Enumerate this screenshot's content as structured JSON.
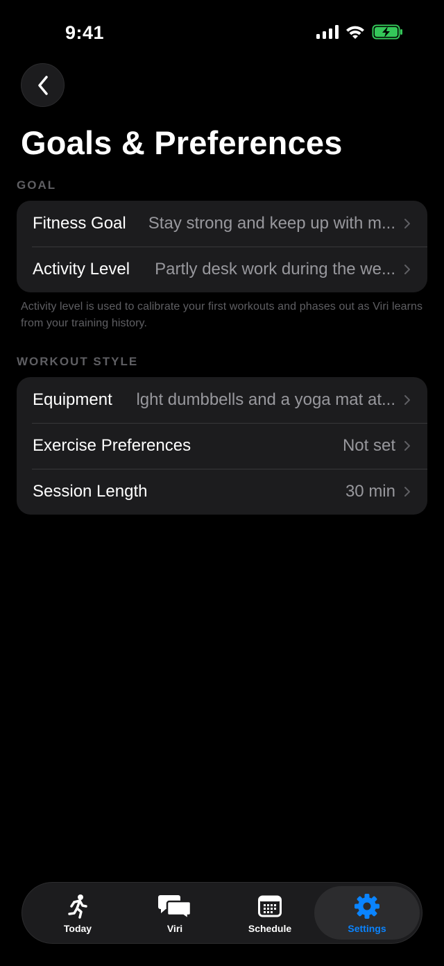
{
  "status_bar": {
    "time": "9:41"
  },
  "header": {
    "back_icon": "chevron-left-icon",
    "title": "Goals & Preferences"
  },
  "goal_section": {
    "header": "GOAL",
    "rows": [
      {
        "label": "Fitness Goal",
        "value": "Stay strong and keep up with m..."
      },
      {
        "label": "Activity Level",
        "value": "Partly desk work during the we..."
      }
    ],
    "footnote": "Activity level is used to calibrate your first workouts and phases out as Viri learns from your training history."
  },
  "workout_section": {
    "header": "WORKOUT STYLE",
    "rows": [
      {
        "label": "Equipment",
        "value": "lght dumbbells and a yoga mat at..."
      },
      {
        "label": "Exercise Preferences",
        "value": "Not set"
      },
      {
        "label": "Session Length",
        "value": "30 min"
      }
    ]
  },
  "tab_bar": {
    "tabs": [
      {
        "label": "Today",
        "icon": "running-figure-icon"
      },
      {
        "label": "Viri",
        "icon": "chat-bubbles-icon"
      },
      {
        "label": "Schedule",
        "icon": "calendar-icon"
      },
      {
        "label": "Settings",
        "icon": "gear-icon"
      }
    ],
    "active": "Settings"
  },
  "colors": {
    "background": "#000000",
    "card": "#1c1c1e",
    "secondary_text": "#98989d",
    "section_header": "#5f5f63",
    "accent": "#0a84ff",
    "battery": "#34c759"
  }
}
